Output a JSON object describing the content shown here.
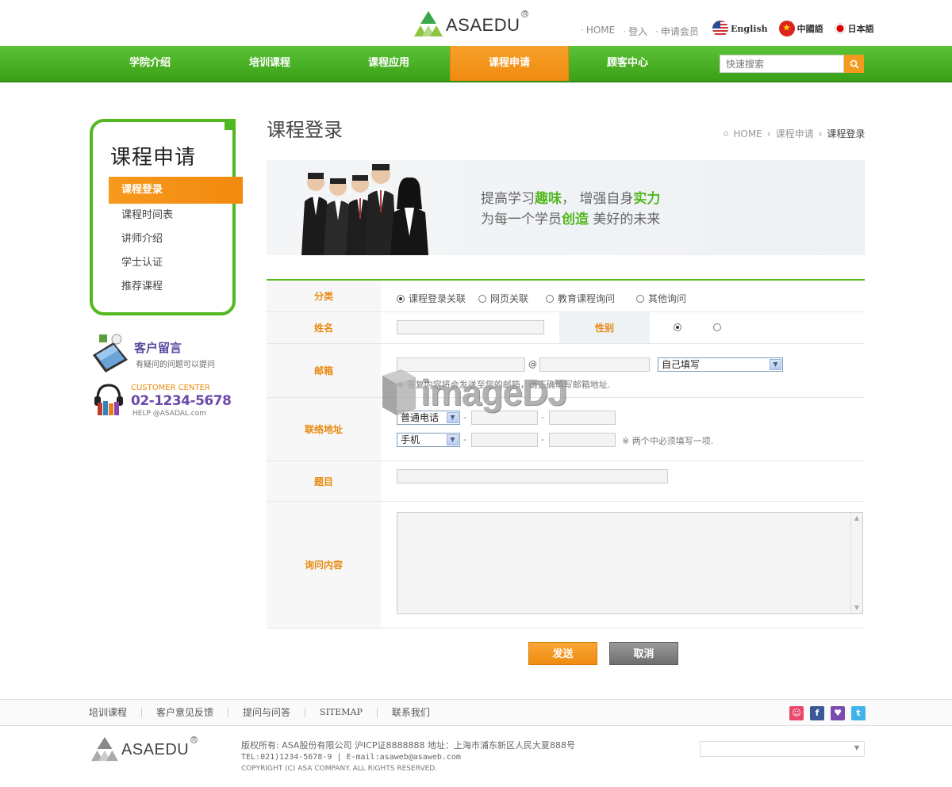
{
  "brand": {
    "name": "ASAEDU",
    "reg": "R"
  },
  "top_links": [
    "HOME",
    "登入",
    "申请会员"
  ],
  "languages": [
    {
      "label": "English",
      "flag": "us"
    },
    {
      "label": "中國語",
      "flag": "cn"
    },
    {
      "label": "日本語",
      "flag": "jp"
    }
  ],
  "nav": {
    "items": [
      "学院介绍",
      "培训课程",
      "课程应用",
      "课程申请",
      "顾客中心"
    ],
    "active": "课程申请"
  },
  "search": {
    "placeholder": "快速搜索"
  },
  "sidebar": {
    "title": "课程申请",
    "items": [
      "课程登录",
      "课程时间表",
      "讲师介绍",
      "学士认证",
      "推荐课程"
    ],
    "active": "课程登录",
    "message": {
      "title": "客户留言",
      "subtitle": "有疑问的问题可以提问"
    },
    "center": {
      "label": "CUSTOMER CENTER",
      "phone": "02-1234-5678",
      "email": "HELP @ASADAL.com"
    }
  },
  "page": {
    "title": "课程登录",
    "breadcrumb": [
      "HOME",
      "课程申请",
      "课程登录"
    ]
  },
  "banner": {
    "line1_a": "提高学习",
    "line1_b": "趣味",
    "line1_c": "， 增强自身",
    "line1_d": "实力",
    "line2_a": "为每一个学员",
    "line2_b": "创造",
    "line2_c": " 美好的未来"
  },
  "form": {
    "category": {
      "label": "分类",
      "options": [
        "课程登录关联",
        "网页关联",
        "教育课程询问",
        "其他询问"
      ],
      "selected": 0
    },
    "name": {
      "label": "姓名",
      "value": ""
    },
    "gender": {
      "label": "性别",
      "selected": 0
    },
    "email": {
      "label": "邮箱",
      "at": "@",
      "domain_select": "自己填写",
      "note": "※ 答复内容将会发送至您的邮箱，请正确填写邮箱地址."
    },
    "contact": {
      "label": "联络地址",
      "phone_select": "普通电话",
      "mobile_select": "手机",
      "dash": "-",
      "note": "※ 两个中必须填写一项."
    },
    "subject": {
      "label": "题目",
      "value": ""
    },
    "content": {
      "label": "询问内容",
      "value": ""
    }
  },
  "buttons": {
    "send": "发送",
    "cancel": "取消"
  },
  "watermark": "imageDJ",
  "footer": {
    "links": [
      "培训课程",
      "客户意见反馈",
      "提问与问答",
      "SITEMAP",
      "联系我们"
    ],
    "socials": [
      "me2day-icon",
      "facebook-icon",
      "yozm-icon",
      "twitter-icon"
    ],
    "company": "版权所有: ASA股份有限公司 沪ICP证8888888 地址：上海市浦东新区人民大夏888号",
    "contact": "TEL:021)1234-5678-9  |  E-mail:asaweb@asaweb.com",
    "copyright": "COPYRIGHT (C) ASA COMPANY. ALL RIGHTS RESERVED."
  },
  "colors": {
    "green": "#52b81f",
    "orange": "#f39a1e",
    "purple": "#6b4aa8"
  }
}
